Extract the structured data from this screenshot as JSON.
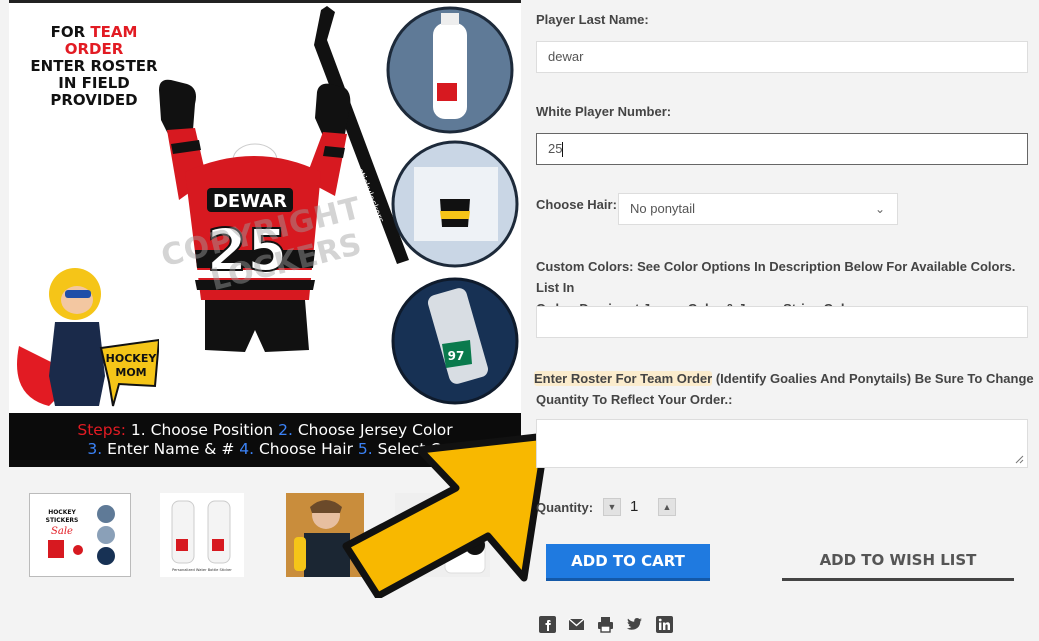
{
  "promo": {
    "line1_a": "FOR ",
    "line1_b": "TEAM",
    "line2": "ORDER",
    "line3": "ENTER ROSTER",
    "line4": "IN FIELD",
    "line5": "PROVIDED"
  },
  "jersey": {
    "name": "DEWAR",
    "number": "25",
    "stick_brand": "stickylockers"
  },
  "watermark": {
    "line1": "COPYRIGHT",
    "line2": "LOCKERS"
  },
  "badge": {
    "line1": "HOCKEY",
    "line2": "MOM"
  },
  "steps": {
    "label": "Steps:",
    "n1": "1.",
    "s1": "Choose Position",
    "n2": "2.",
    "s2": "Choose Jersey Color",
    "n3": "3.",
    "s3": "Enter Name & #",
    "n4": "4.",
    "s4": "Choose Hair",
    "n5": "5.",
    "s5": "Select Q"
  },
  "circles": {
    "sticker_number": "97"
  },
  "thumbnails": {
    "t1_line1": "HOCKEY",
    "t1_line2": "STICKERS",
    "t1_line3": "Sale",
    "t2_caption": "Personalized Water Bottle Sticker"
  },
  "form": {
    "last_name_label": "Player Last Name:",
    "last_name_value": "dewar",
    "number_label": "White Player Number:",
    "number_value": "25",
    "hair_label": "Choose Hair:",
    "hair_value": "No ponytail",
    "colors_label_1": "Custom Colors: See Color Options In Description Below For Available Colors. List In",
    "colors_label_2": "Order: Dominant Jersey Color & Jersey Stripe Color:",
    "colors_value": "",
    "roster_label_hl": "Enter Roster For Team Order",
    "roster_label_rest": " (Identify Goalies And Ponytails) Be Sure To Change",
    "roster_label_2": "Quantity To Reflect Your Order.:",
    "roster_value": "",
    "quantity_label": "Quantity:",
    "quantity_value": "1"
  },
  "buttons": {
    "add_to_cart": "ADD TO CART",
    "add_to_wishlist": "ADD TO WISH LIST"
  },
  "share_icons": [
    "facebook-icon",
    "email-icon",
    "print-icon",
    "twitter-icon",
    "linkedin-icon"
  ],
  "colors": {
    "accent_blue": "#1f7ae0",
    "arrow_yellow": "#f8b800",
    "jersey_red": "#e21b23",
    "highlight": "#fbeccd"
  }
}
